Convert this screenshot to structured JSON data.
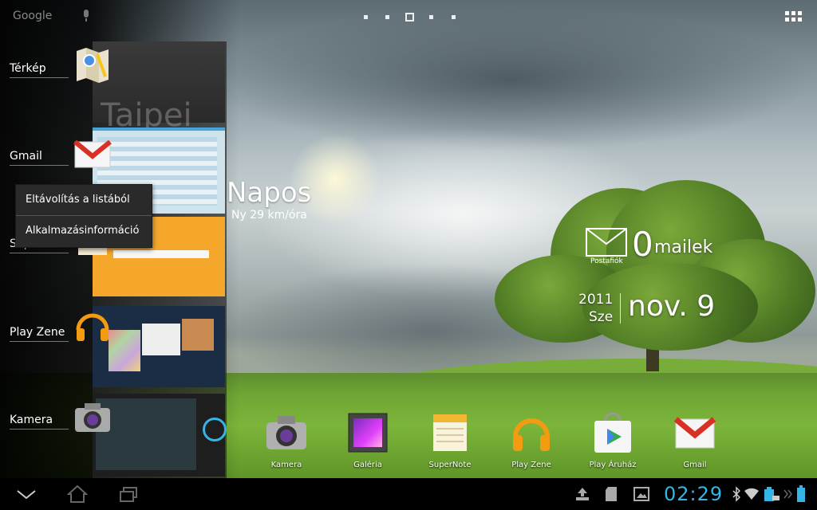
{
  "top_bar": {
    "search_label": "Google",
    "home_pages": 5,
    "current_page": 3
  },
  "recent_apps": [
    {
      "label": "Térkép",
      "icon": "maps-icon"
    },
    {
      "label": "Gmail",
      "icon": "gmail-icon"
    },
    {
      "label": "SuperNote",
      "icon": "supernote-icon"
    },
    {
      "label": "Play Zene",
      "icon": "play-music-icon"
    },
    {
      "label": "Kamera",
      "icon": "camera-icon"
    }
  ],
  "recent_thumb_texts": {
    "taipei_city": "Taipei"
  },
  "context_menu": {
    "items": [
      "Eltávolítás a listából",
      "Alkalmazásinformáció"
    ]
  },
  "weather_widget": {
    "condition": "Napos",
    "wind": "Ny 29 km/óra"
  },
  "email_widget": {
    "count": "0",
    "label": "mailek",
    "sublabel": "Postafiók"
  },
  "date_widget": {
    "year": "2011",
    "month": "Sze",
    "day": "nov. 9"
  },
  "dock": [
    {
      "label": "Kamera",
      "icon": "camera-icon"
    },
    {
      "label": "Galéria",
      "icon": "gallery-icon"
    },
    {
      "label": "SuperNote",
      "icon": "supernote-icon"
    },
    {
      "label": "Play Zene",
      "icon": "play-music-icon"
    },
    {
      "label": "Play Áruház",
      "icon": "play-store-icon"
    },
    {
      "label": "Gmail",
      "icon": "gmail-icon"
    }
  ],
  "status_bar": {
    "time": "02:29"
  },
  "colors": {
    "clock": "#34b5e5",
    "nav_bar": "#000000"
  }
}
